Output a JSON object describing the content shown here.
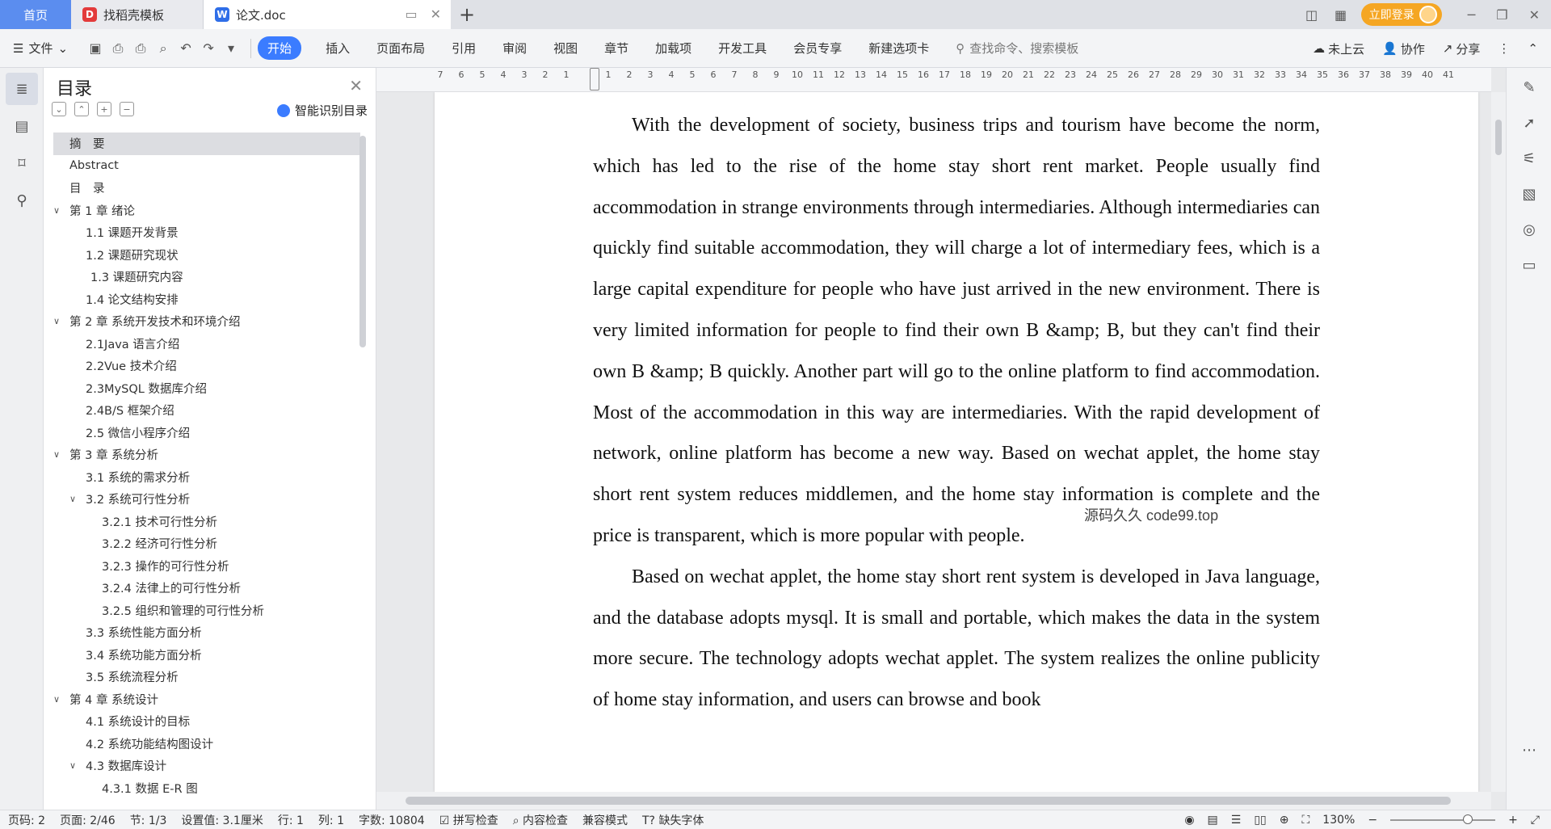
{
  "tabs": {
    "home": "首页",
    "templates": "找稻壳模板",
    "document": "论文.doc"
  },
  "account": {
    "login_label": "立即登录"
  },
  "ribbon": {
    "file_label": "文件",
    "tabs": [
      "开始",
      "插入",
      "页面布局",
      "引用",
      "审阅",
      "视图",
      "章节",
      "加载项",
      "开发工具",
      "会员专享",
      "新建选项卡"
    ],
    "search_placeholder": "查找命令、搜索模板",
    "cloud_label": "未上云",
    "collab_label": "协作",
    "share_label": "分享"
  },
  "toc": {
    "title": "目录",
    "smart_label": "智能识别目录",
    "items": [
      {
        "label": "摘　要",
        "level": 0,
        "chev": "",
        "selected": true
      },
      {
        "label": "Abstract",
        "level": 0,
        "chev": ""
      },
      {
        "label": "目　录",
        "level": 0,
        "chev": ""
      },
      {
        "label": "第 1 章  绪论",
        "level": 0,
        "chev": "v"
      },
      {
        "label": "1.1 课题开发背景",
        "level": 1,
        "chev": ""
      },
      {
        "label": "1.2 课题研究现状",
        "level": 1,
        "chev": ""
      },
      {
        "label": "1.3 课题研究内容",
        "level": 1,
        "chev": "",
        "extra": true
      },
      {
        "label": "1.4 论文结构安排",
        "level": 1,
        "chev": ""
      },
      {
        "label": "第 2 章  系统开发技术和环境介绍",
        "level": 0,
        "chev": "v"
      },
      {
        "label": "2.1Java 语言介绍",
        "level": 1,
        "chev": ""
      },
      {
        "label": "2.2Vue 技术介绍",
        "level": 1,
        "chev": ""
      },
      {
        "label": "2.3MySQL 数据库介绍",
        "level": 1,
        "chev": ""
      },
      {
        "label": "2.4B/S 框架介绍",
        "level": 1,
        "chev": ""
      },
      {
        "label": "2.5 微信小程序介绍",
        "level": 1,
        "chev": ""
      },
      {
        "label": "第 3 章  系统分析",
        "level": 0,
        "chev": "v"
      },
      {
        "label": "3.1 系统的需求分析",
        "level": 1,
        "chev": ""
      },
      {
        "label": "3.2 系统可行性分析",
        "level": 1,
        "chev": "v"
      },
      {
        "label": "3.2.1 技术可行性分析",
        "level": 2,
        "chev": ""
      },
      {
        "label": "3.2.2 经济可行性分析",
        "level": 2,
        "chev": ""
      },
      {
        "label": "3.2.3 操作的可行性分析",
        "level": 2,
        "chev": ""
      },
      {
        "label": "3.2.4 法律上的可行性分析",
        "level": 2,
        "chev": ""
      },
      {
        "label": "3.2.5 组织和管理的可行性分析",
        "level": 2,
        "chev": ""
      },
      {
        "label": "3.3 系统性能方面分析",
        "level": 1,
        "chev": ""
      },
      {
        "label": "3.4 系统功能方面分析",
        "level": 1,
        "chev": ""
      },
      {
        "label": "3.5 系统流程分析",
        "level": 1,
        "chev": ""
      },
      {
        "label": "第 4 章  系统设计",
        "level": 0,
        "chev": "v"
      },
      {
        "label": "4.1 系统设计的目标",
        "level": 1,
        "chev": ""
      },
      {
        "label": "4.2 系统功能结构图设计",
        "level": 1,
        "chev": ""
      },
      {
        "label": "4.3 数据库设计",
        "level": 1,
        "chev": "v"
      },
      {
        "label": "4.3.1 数据 E-R 图",
        "level": 2,
        "chev": ""
      }
    ]
  },
  "ruler": {
    "numbers": [
      "7",
      "6",
      "5",
      "4",
      "3",
      "2",
      "1",
      "",
      "1",
      "2",
      "3",
      "4",
      "5",
      "6",
      "7",
      "8",
      "9",
      "10",
      "11",
      "12",
      "13",
      "14",
      "15",
      "16",
      "17",
      "18",
      "19",
      "20",
      "21",
      "22",
      "23",
      "24",
      "25",
      "26",
      "27",
      "28",
      "29",
      "30",
      "31",
      "32",
      "33",
      "34",
      "35",
      "36",
      "37",
      "38",
      "39",
      "40",
      "41"
    ]
  },
  "document": {
    "paragraphs": [
      "With the development of society, business trips and tourism have become the norm, which has led to the rise of the home stay short rent market. People usually find accommodation in strange environments through intermediaries. Although intermediaries can quickly find suitable accommodation, they will charge a lot of intermediary fees, which is a large capital expenditure for people who have just arrived in the new environment. There is very limited information for people to find their own B &amp; B, but they can't find their own B &amp; B quickly. Another part will go to the online platform to find accommodation. Most of the accommodation in this way are intermediaries. With the rapid development of network, online platform has become a new way. Based on wechat applet, the home stay short rent system reduces middlemen, and the home stay information is complete and the price is transparent, which is more popular with people.",
      "Based on wechat applet, the home stay short rent system is developed in Java language, and the database adopts mysql. It is small and portable, which makes the data in the system more secure. The technology adopts wechat applet. The system realizes the online publicity of home stay information, and users can browse and book"
    ],
    "watermark": "源码久久 code99.top"
  },
  "status": {
    "page_code": "页码: 2",
    "page": "页面: 2/46",
    "section": "节: 1/3",
    "setting": "设置值: 3.1厘米",
    "row": "行: 1",
    "col": "列: 1",
    "word_count": "字数: 10804",
    "spell_check": "拼写检查",
    "content_check": "内容检查",
    "compat_mode": "兼容模式",
    "missing_font": "缺失字体",
    "zoom": "130%"
  }
}
